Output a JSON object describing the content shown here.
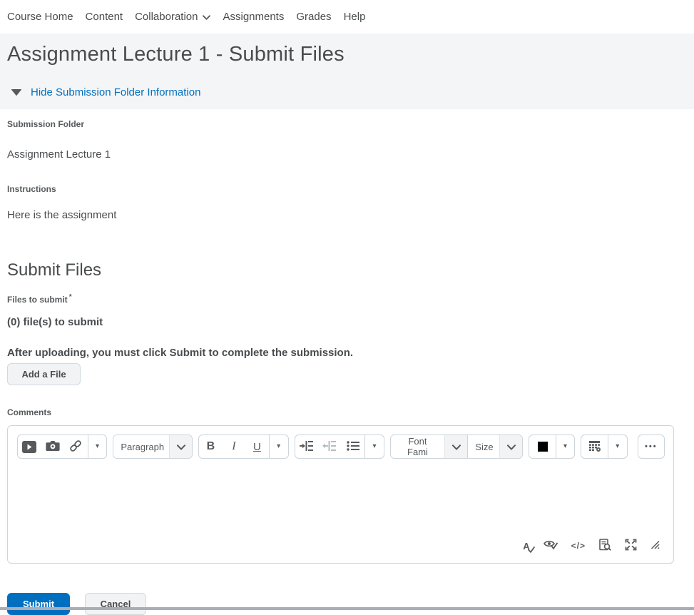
{
  "nav": {
    "items": [
      {
        "label": "Course Home"
      },
      {
        "label": "Content"
      },
      {
        "label": "Collaboration",
        "has_dropdown": true
      },
      {
        "label": "Assignments"
      },
      {
        "label": "Grades"
      },
      {
        "label": "Help"
      }
    ]
  },
  "header": {
    "title": "Assignment Lecture 1 - Submit Files",
    "toggle_link": "Hide Submission Folder Information"
  },
  "folder_info": {
    "submission_folder_label": "Submission Folder",
    "submission_folder_value": "Assignment Lecture 1",
    "instructions_label": "Instructions",
    "instructions_value": "Here is the assignment"
  },
  "submit_section": {
    "heading": "Submit Files",
    "files_label": "Files to submit",
    "required_marker": "*",
    "files_count": "(0) file(s) to submit",
    "upload_note": "After uploading, you must click Submit to complete the submission.",
    "add_file_button": "Add a File"
  },
  "comments": {
    "label": "Comments",
    "editor": {
      "paragraph_dropdown": "Paragraph",
      "font_family_dropdown": "Font Fami",
      "font_size_dropdown": "Size",
      "bold": "B",
      "italic": "I",
      "underline": "U",
      "color_swatch": "#000000"
    }
  },
  "icons": {
    "caret_down": "▾",
    "overflow_dots": "•••",
    "html_source": "</>",
    "accessibility_letter": "A"
  },
  "actions": {
    "submit": "Submit",
    "cancel": "Cancel"
  },
  "colors": {
    "link_blue": "#006fbf",
    "primary_button": "#006fbf",
    "header_background": "#f4f5f6",
    "icon_gray": "#565a5c"
  }
}
